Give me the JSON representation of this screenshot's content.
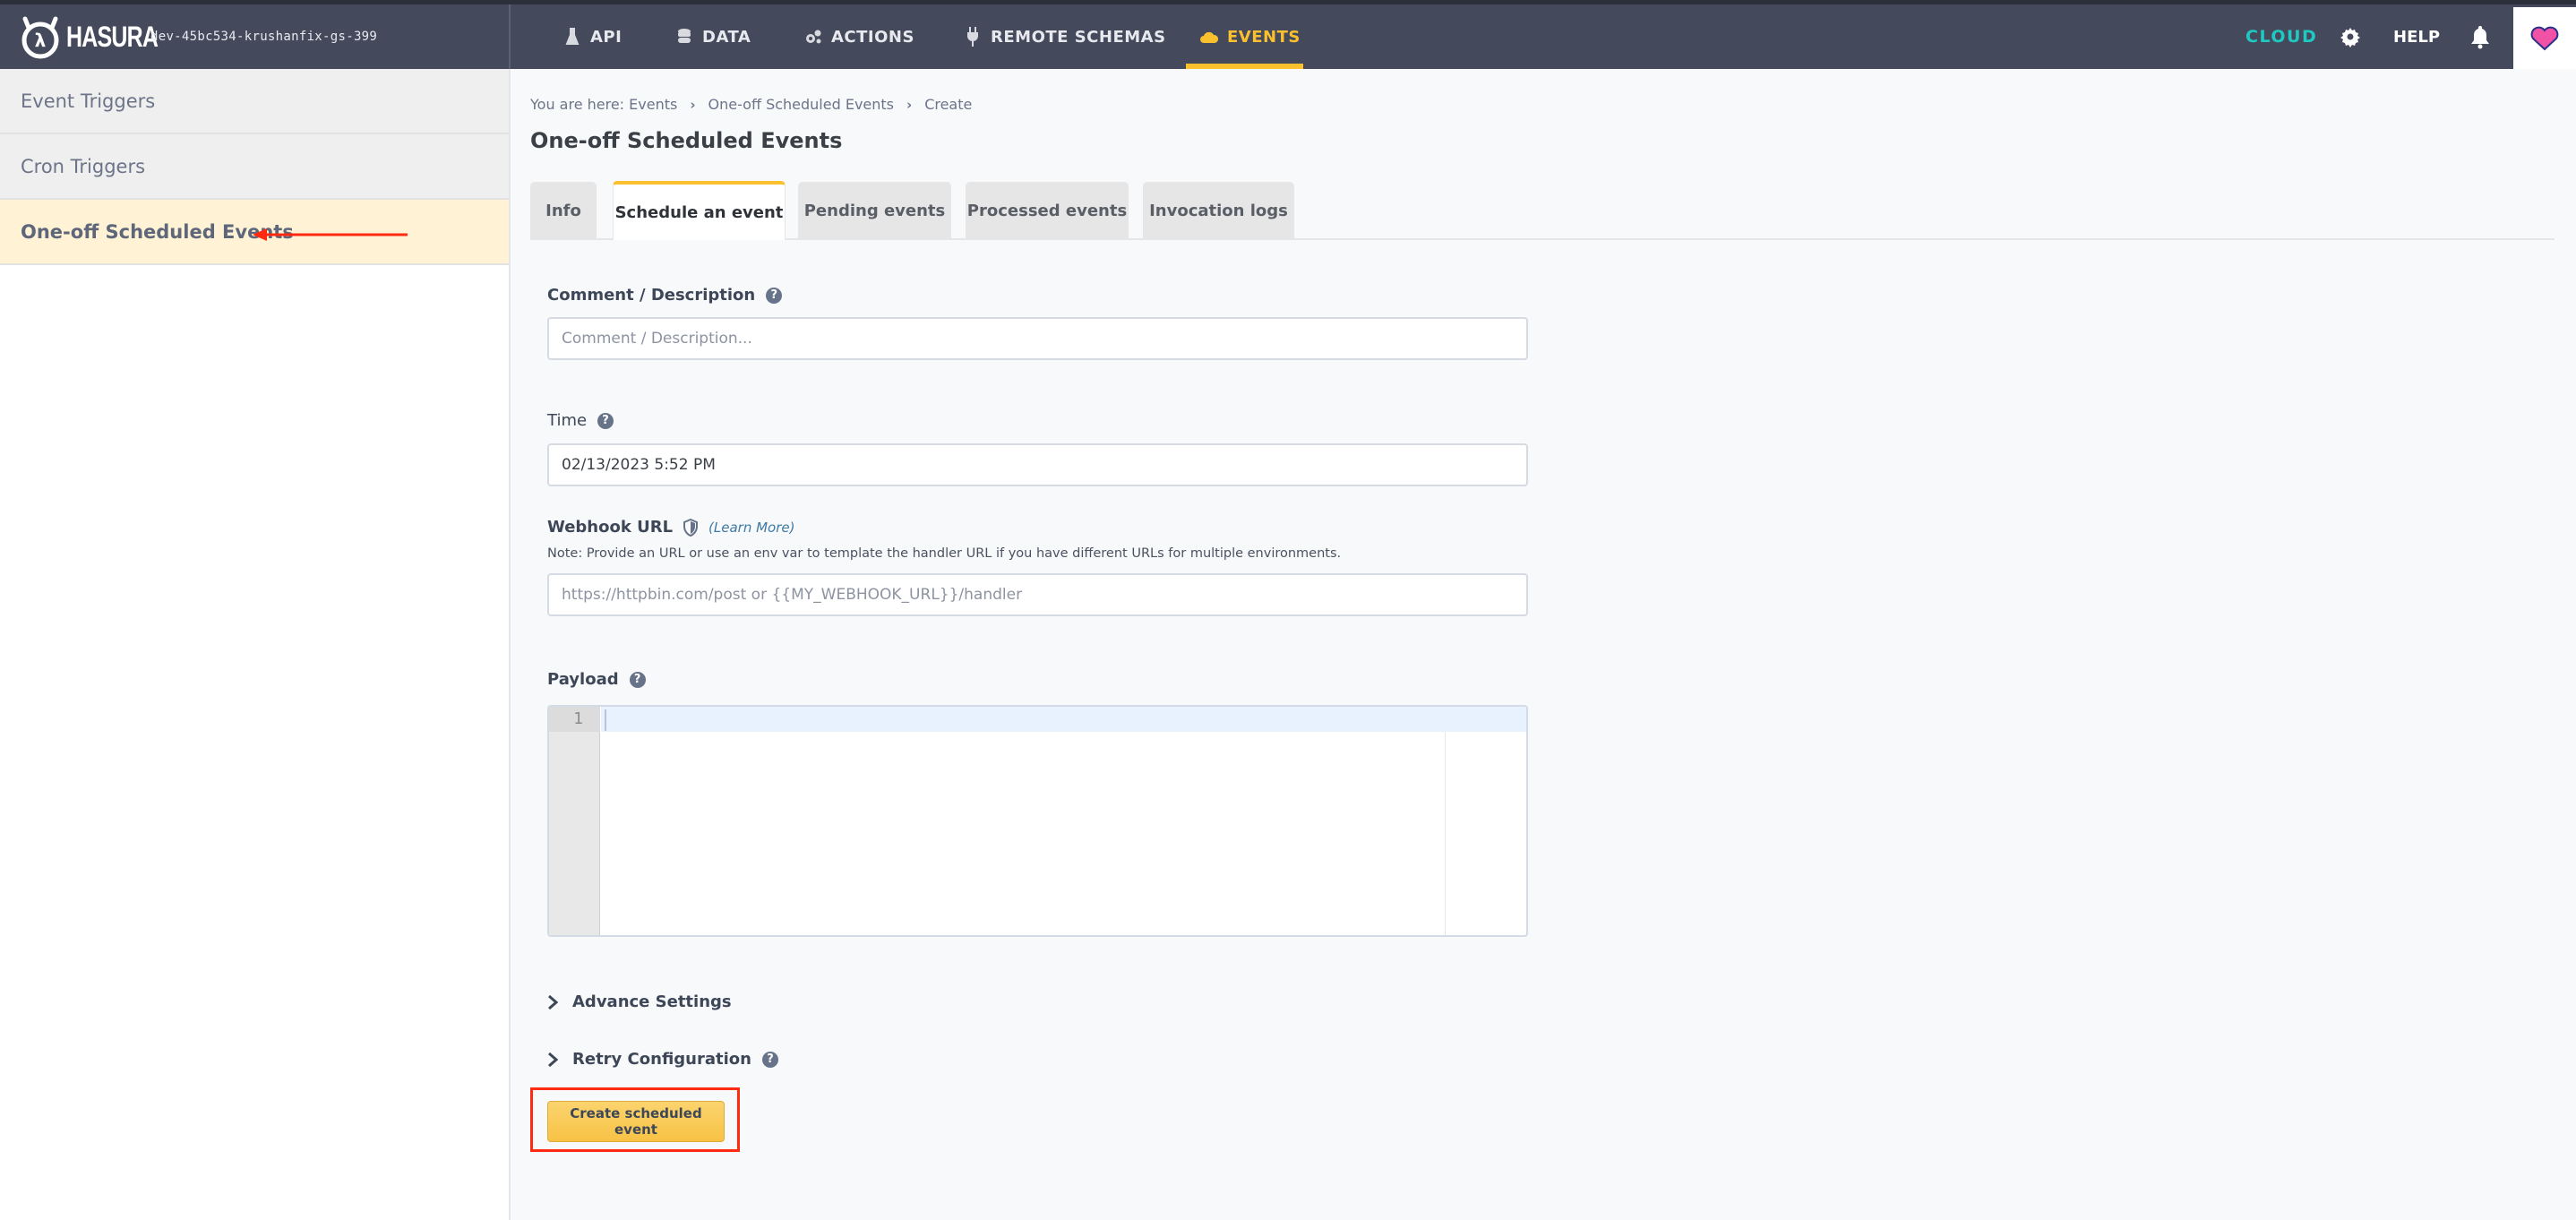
{
  "navbar": {
    "brand": "HASURA",
    "project": "dev-45bc534-krushanfix-gs-399",
    "items": [
      {
        "label": "API",
        "icon": "flask-icon"
      },
      {
        "label": "DATA",
        "icon": "database-icon"
      },
      {
        "label": "ACTIONS",
        "icon": "cogs-icon"
      },
      {
        "label": "REMOTE SCHEMAS",
        "icon": "plug-icon"
      },
      {
        "label": "EVENTS",
        "icon": "cloud-icon",
        "active": true
      }
    ],
    "cloud": "CLOUD",
    "help": "HELP",
    "accent": "#fbc02d",
    "cloud_color": "#1fc8c0"
  },
  "sidebar": {
    "items": [
      {
        "label": "Event Triggers"
      },
      {
        "label": "Cron Triggers"
      },
      {
        "label": "One-off Scheduled Events",
        "active": true
      }
    ]
  },
  "breadcrumb": {
    "prefix": "You are here: Events",
    "middle": "One-off Scheduled Events",
    "last": "Create"
  },
  "page": {
    "title": "One-off Scheduled Events",
    "tabs": [
      {
        "label": "Info"
      },
      {
        "label": "Schedule an event",
        "active": true
      },
      {
        "label": "Pending events"
      },
      {
        "label": "Processed events"
      },
      {
        "label": "Invocation logs"
      }
    ]
  },
  "form": {
    "comment": {
      "label": "Comment / Description",
      "placeholder": "Comment / Description...",
      "value": ""
    },
    "time": {
      "label": "Time",
      "value": "02/13/2023 5:52 PM"
    },
    "webhook": {
      "label": "Webhook URL",
      "learn_more": "(Learn More)",
      "note": "Note: Provide an URL or use an env var to template the handler URL if you have different URLs for multiple environments.",
      "placeholder": "https://httpbin.com/post or {{MY_WEBHOOK_URL}}/handler",
      "value": ""
    },
    "payload": {
      "label": "Payload",
      "line_number": "1"
    },
    "advance_settings": "Advance Settings",
    "retry_configuration": "Retry Configuration",
    "submit": "Create scheduled event",
    "help_glyph": "?"
  }
}
